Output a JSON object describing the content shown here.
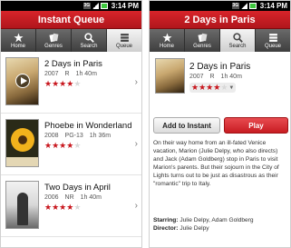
{
  "status_bar": {
    "time": "3:14 PM",
    "network": "3G"
  },
  "tabs": [
    {
      "label": "Home",
      "icon": "star-icon"
    },
    {
      "label": "Genres",
      "icon": "cards-icon"
    },
    {
      "label": "Search",
      "icon": "search-icon"
    },
    {
      "label": "Queue",
      "icon": "queue-icon"
    }
  ],
  "queue_screen": {
    "title": "Instant Queue",
    "active_tab": "Queue",
    "items": [
      {
        "title": "2 Days in Paris",
        "year": "2007",
        "rating": "R",
        "duration": "1h 40m",
        "stars": 3.5
      },
      {
        "title": "Phoebe in Wonderland",
        "year": "2008",
        "rating": "PG-13",
        "duration": "1h 36m",
        "stars": 3.5
      },
      {
        "title": "Two Days in April",
        "year": "2006",
        "rating": "NR",
        "duration": "1h 40m",
        "stars": 3.5
      }
    ]
  },
  "detail_screen": {
    "title": "2 Days in Paris",
    "active_tab": "Search",
    "movie_title": "2 Days in Paris",
    "year": "2007",
    "rating": "R",
    "duration": "1h 40m",
    "stars": 3.5,
    "add_button": "Add to Instant",
    "play_button": "Play",
    "synopsis": "On their way home from an ill-fated Venice vacation, Marion (Julie Delpy, who also directs) and Jack (Adam Goldberg) stop in Paris to visit Marion's parents. But their sojourn in the City of Lights turns out to be just as disastrous as their \"romantic\" trip to Italy.",
    "starring_label": "Starring:",
    "starring": "Julie Delpy, Adam Goldberg",
    "director_label": "Director:",
    "director": "Julie Delpy"
  },
  "colors": {
    "brand_red": "#c81c22",
    "star_red": "#c8161d",
    "tab_dark": "#4a4a4a"
  }
}
